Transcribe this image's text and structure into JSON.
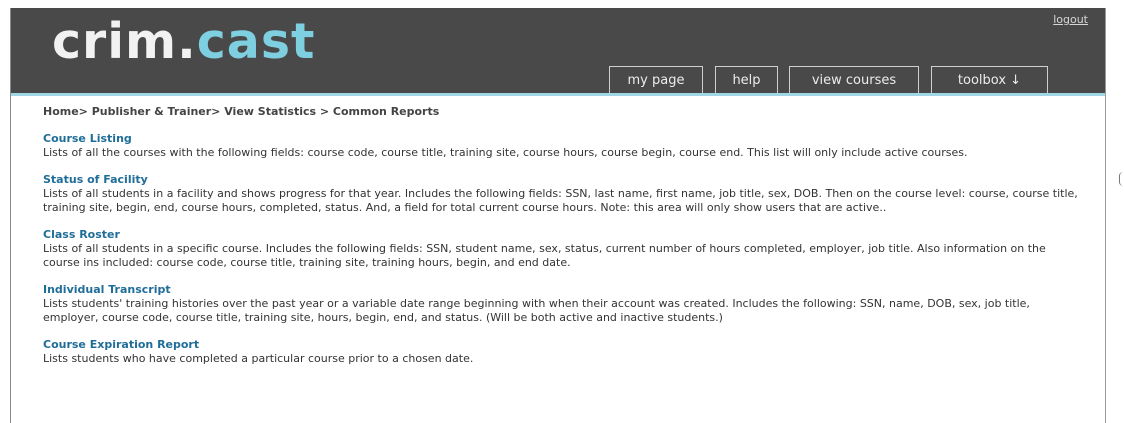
{
  "header": {
    "logo": {
      "part1": "crim",
      "part2": ".",
      "part3": "cast"
    },
    "logout_label": "logout",
    "nav": [
      {
        "label": "my page"
      },
      {
        "label": "help"
      },
      {
        "label": "view courses"
      },
      {
        "label": "toolbox ↓"
      }
    ]
  },
  "breadcrumb": "Home> Publisher & Trainer> View Statistics > Common Reports",
  "reports": [
    {
      "title": "Course Listing",
      "description": "Lists of all the courses with the following fields: course code, course title, training site, course hours, course begin, course end. This list will only include active courses."
    },
    {
      "title": "Status of Facility",
      "description": "Lists of all students in a facility and shows progress for that year. Includes the following fields: SSN, last name, first name, job title, sex, DOB. Then on the course level: course, course title, training site, begin, end, course hours, completed, status. And, a field for total current course hours. Note: this area will only show users that are active.."
    },
    {
      "title": "Class Roster",
      "description": "Lists of all students in a specific course. Includes the following fields: SSN, student name, sex, status, current number of hours completed, employer, job title. Also information on the course ins included: course code, course title, training site, training hours, begin, and end date."
    },
    {
      "title": "Individual Transcript",
      "description": "Lists students' training histories over the past year or a variable date range beginning with when their account was created. Includes the following: SSN, name, DOB, sex, job title, employer, course code, course title, training site, hours, begin, end, and status. (Will be both active and inactive students.)"
    },
    {
      "title": "Course Expiration Report",
      "description": "Lists students who have completed a particular course prior to a chosen date."
    }
  ],
  "colors": {
    "header_bg": "#4a4949",
    "accent": "#9fd8e4",
    "logo_accent": "#7ecfe0",
    "link": "#1f6d98"
  }
}
